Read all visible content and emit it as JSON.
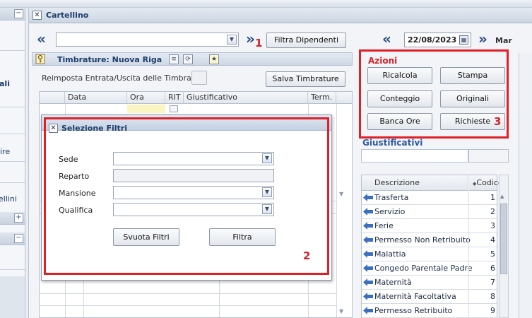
{
  "left_panel": {
    "fragments": [
      "ali",
      "ire",
      "ellini"
    ],
    "collapse_symbol": "−",
    "expand_symbol": "+"
  },
  "window": {
    "title": "Cartellino",
    "close_symbol": "✕"
  },
  "toolbar": {
    "prev_symbol": "«",
    "next_symbol": "»",
    "employee_select_value": "",
    "filter_employees_label": "Filtra Dipendenti"
  },
  "timbrature": {
    "section_title": "Timbrature: Nuova Riga",
    "reset_label": "Reimposta Entrata/Uscita delle Timbrature",
    "save_label": "Salva Timbrature",
    "columns": [
      "Data",
      "Ora",
      "RIT",
      "Giustificativo",
      "Term."
    ]
  },
  "date_nav": {
    "date": "22/08/2023",
    "day": "Mar",
    "prev_symbol": "«",
    "next_symbol": "»"
  },
  "azioni": {
    "title": "Azioni",
    "buttons": [
      "Ricalcola",
      "Stampa",
      "Conteggio",
      "Originali",
      "Banca Ore",
      "Richieste"
    ]
  },
  "giustificativi": {
    "title": "Giustificativi",
    "columns": [
      "Descrizione",
      "Codice"
    ],
    "rows": [
      {
        "desc": "Trasferta",
        "code": "1"
      },
      {
        "desc": "Servizio",
        "code": "2"
      },
      {
        "desc": "Ferie",
        "code": "3"
      },
      {
        "desc": "Permesso Non Retribuito",
        "code": "4"
      },
      {
        "desc": "Malattia",
        "code": "5"
      },
      {
        "desc": "Congedo Parentale Padre",
        "code": "6"
      },
      {
        "desc": "Maternità",
        "code": "7"
      },
      {
        "desc": "Maternità Facoltativa",
        "code": "8"
      },
      {
        "desc": "Permesso Retribuito",
        "code": "9"
      }
    ]
  },
  "modal": {
    "title": "Selezione Filtri",
    "close_symbol": "✕",
    "fields": {
      "sede_label": "Sede",
      "sede_value": "",
      "reparto_label": "Reparto",
      "reparto_value": "",
      "mansione_label": "Mansione",
      "mansione_value": "",
      "qualifica_label": "Qualifica",
      "qualifica_value": ""
    },
    "clear_label": "Svuota Filtri",
    "apply_label": "Filtra"
  },
  "annotations": [
    "1",
    "2",
    "3"
  ],
  "colors": {
    "annotation_red": "#e01f26",
    "header_blue": "#1e3d6b",
    "azioni_red": "#d4222a",
    "giustificativi_blue": "#2c5aa0",
    "arrow_blue": "#3b6fbf"
  }
}
